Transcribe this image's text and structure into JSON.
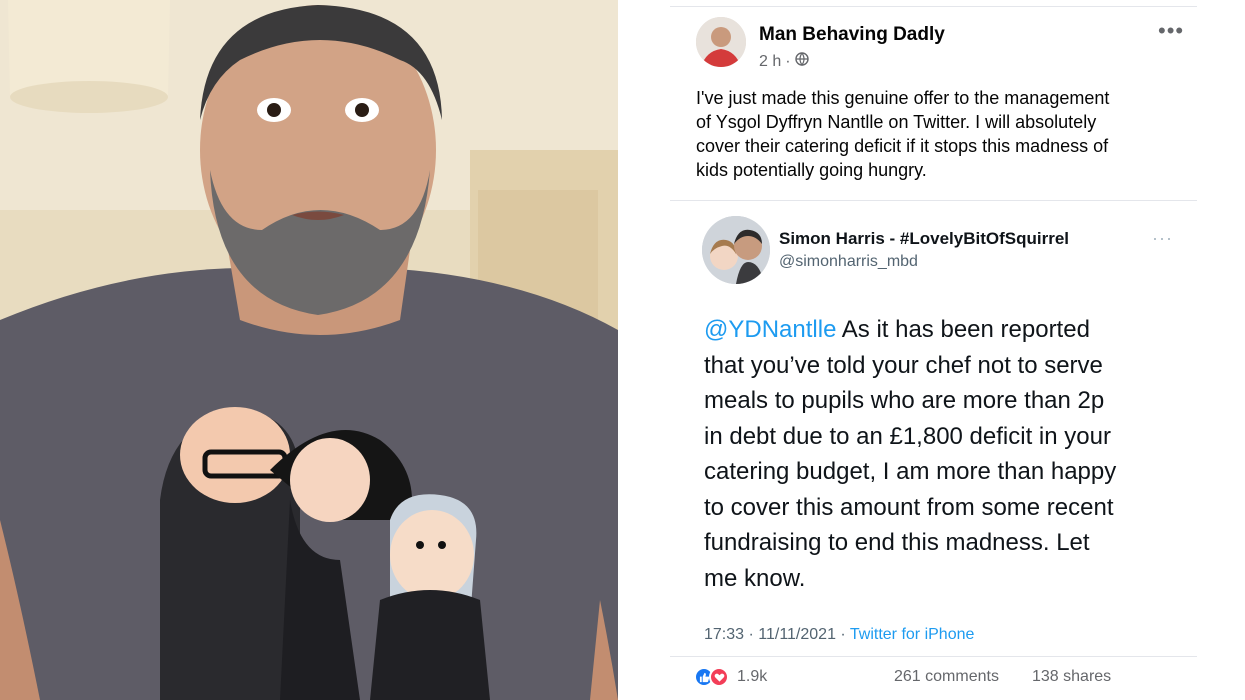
{
  "facebook_post": {
    "author": "Man Behaving Dadly",
    "time": "2 h",
    "separator": "·",
    "more_icon": "more-dots-icon",
    "privacy_icon": "globe-icon",
    "text_lines": [
      "I've just made this genuine offer to the management",
      "of Ysgol Dyffryn Nantlle on Twitter. I will absolutely",
      "cover their catering deficit if it stops this madness of",
      "kids potentially going hungry."
    ]
  },
  "tweet": {
    "display_name": "Simon Harris - #LovelyBitOfSquirrel",
    "handle": "@simonharris_mbd",
    "mention": "@YDNantlle",
    "text_lines": [
      " As it has been reported",
      "that you’ve told your chef not to serve",
      "meals to pupils who are more than 2p",
      "in debt due to an £1,800 deficit in your",
      "catering budget, I am more than happy",
      "to cover this amount from some recent",
      "fundraising to end this madness. Let",
      "me know."
    ],
    "timestamp": "17:33 · 11/11/2021 · ",
    "source": "Twitter for iPhone"
  },
  "engagement": {
    "reaction_count": "1.9k",
    "comments": "261 comments",
    "shares": "138 shares"
  },
  "colors": {
    "link_blue": "#1d9bf0",
    "like_blue": "#1877f2",
    "love_red": "#f33e58"
  }
}
